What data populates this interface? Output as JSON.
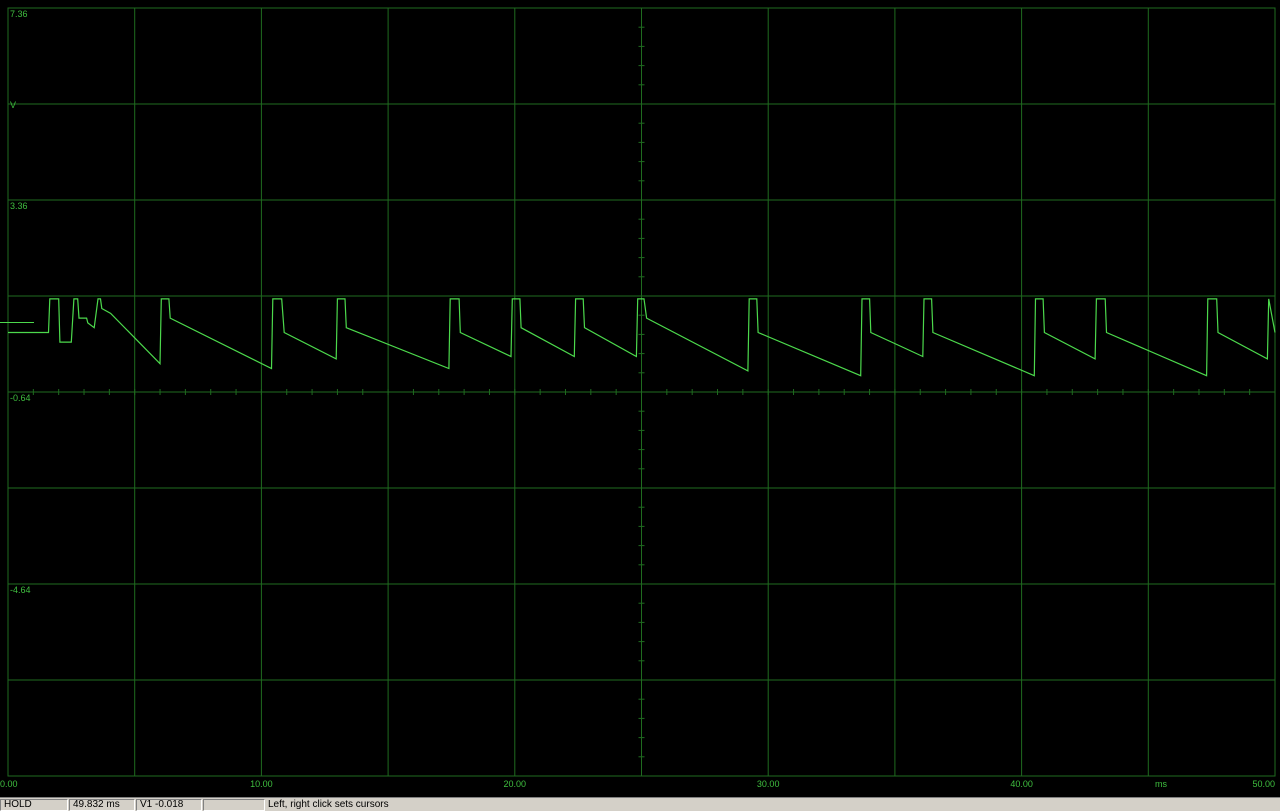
{
  "scope": {
    "colors": {
      "grid": "#1f6b1f",
      "trace": "#4cd94c",
      "label": "#3fbf3f",
      "background": "#000000"
    },
    "y_labels": [
      "7.36",
      "3.36",
      "-0.64",
      "-4.64"
    ],
    "y_unit": "V",
    "x_labels": [
      "0.00",
      "10.00",
      "20.00",
      "30.00",
      "40.00",
      "50.00"
    ],
    "x_unit": "ms"
  },
  "chart_data": {
    "type": "line",
    "title": "",
    "xlabel": "ms",
    "ylabel": "V",
    "xlim": [
      0,
      50
    ],
    "ylim": [
      -8.64,
      7.36
    ],
    "grid": true,
    "series": [
      {
        "x": [
          0.0,
          1.0,
          1.6,
          1.65,
          2.0,
          2.05,
          2.5,
          2.6,
          2.75,
          2.8,
          3.1,
          3.15,
          3.4,
          3.55,
          3.65,
          3.7,
          4.05,
          6.0,
          6.05,
          6.35,
          6.4,
          10.4,
          10.45,
          10.8,
          10.9,
          12.95,
          13.0,
          13.3,
          13.35,
          17.4,
          17.45,
          17.8,
          17.85,
          19.85,
          19.9,
          20.2,
          20.25,
          22.35,
          22.4,
          22.7,
          22.75,
          24.8,
          24.85,
          25.1,
          25.2,
          29.2,
          29.25,
          29.55,
          29.6,
          33.65,
          33.7,
          34.0,
          34.05,
          36.1,
          36.15,
          36.45,
          36.5,
          40.5,
          40.55,
          40.85,
          40.9,
          42.9,
          42.95,
          43.3,
          43.35,
          47.3,
          47.35,
          47.7,
          47.75,
          49.7,
          49.75,
          50.0
        ],
        "y": [
          0.6,
          0.6,
          0.6,
          1.3,
          1.3,
          0.4,
          0.4,
          1.3,
          1.3,
          0.9,
          0.9,
          0.8,
          0.7,
          1.3,
          1.3,
          1.1,
          1.0,
          -0.05,
          1.3,
          1.3,
          0.9,
          -0.15,
          1.3,
          1.3,
          0.6,
          0.05,
          1.3,
          1.3,
          0.7,
          -0.15,
          1.3,
          1.3,
          0.6,
          0.1,
          1.3,
          1.3,
          0.7,
          0.1,
          1.3,
          1.3,
          0.7,
          0.1,
          1.3,
          1.3,
          0.9,
          -0.2,
          1.3,
          1.3,
          0.6,
          -0.3,
          1.3,
          1.3,
          0.6,
          0.1,
          1.3,
          1.3,
          0.6,
          -0.3,
          1.3,
          1.3,
          0.6,
          0.05,
          1.3,
          1.3,
          0.6,
          -0.3,
          1.3,
          1.3,
          0.6,
          0.05,
          1.3,
          0.6
        ]
      }
    ]
  },
  "statusbar": {
    "mode": "HOLD",
    "time": "49.832 ms",
    "voltage": "V1 -0.018",
    "blank": "",
    "hint": "Left, right click sets cursors"
  }
}
